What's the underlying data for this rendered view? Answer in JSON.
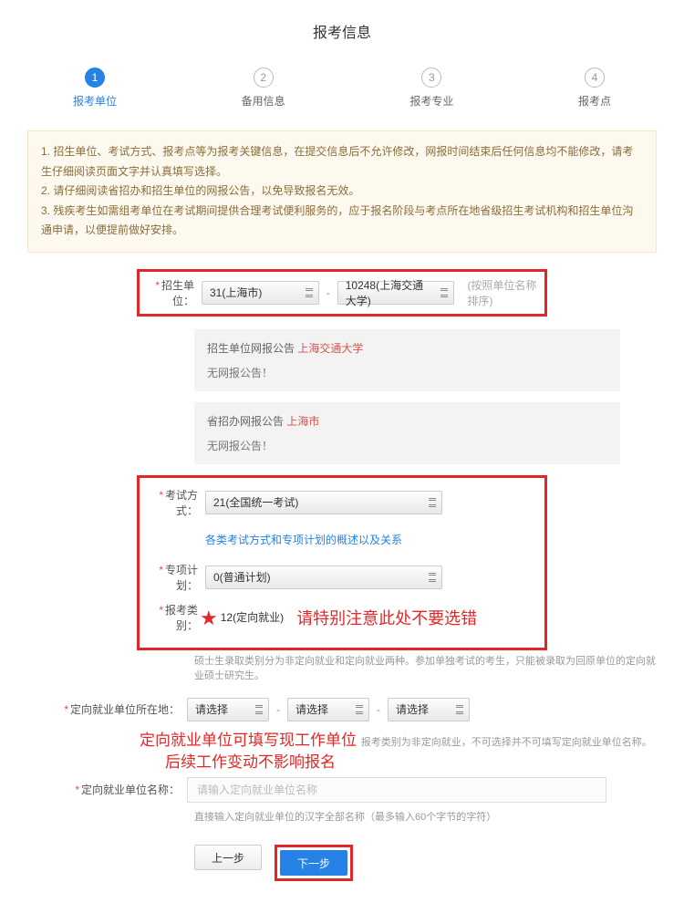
{
  "title": "报考信息",
  "steps": [
    {
      "num": "1",
      "label": "报考单位",
      "active": true
    },
    {
      "num": "2",
      "label": "备用信息",
      "active": false
    },
    {
      "num": "3",
      "label": "报考专业",
      "active": false
    },
    {
      "num": "4",
      "label": "报考点",
      "active": false
    }
  ],
  "infoBox": {
    "line1": "1. 招生单位、考试方式、报考点等为报考关键信息，在提交信息后不允许修改，网报时间结束后任何信息均不能修改，请考生仔细阅读页面文字并认真填写选择。",
    "line2": "2. 请仔细阅读省招办和招生单位的网报公告，以免导致报名无效。",
    "line3": "3. 残疾考生如需组考单位在考试期间提供合理考试便利服务的，应于报名阶段与考点所在地省级招生考试机构和招生单位沟通申请，以便提前做好安排。"
  },
  "fields": {
    "unit": {
      "label": "招生单位：",
      "province": "31(上海市)",
      "school": "10248(上海交通大学)",
      "hint": "(按照单位名称排序)"
    },
    "unitNotice": {
      "titlePrefix": "招生单位网报公告 ",
      "titleRed": "上海交通大学",
      "body": "无网报公告！"
    },
    "provNotice": {
      "titlePrefix": "省招办网报公告 ",
      "titleRed": "上海市",
      "body": "无网报公告！"
    },
    "exam": {
      "label": "考试方式：",
      "value": "21(全国统一考试)",
      "link": "各类考试方式和专项计划的概述以及关系"
    },
    "plan": {
      "label": "专项计划：",
      "value": "0(普通计划)"
    },
    "category": {
      "label": "报考类别：",
      "value": "12(定向就业)",
      "callout": "请特别注意此处不要选错"
    },
    "categoryNote": "硕士生录取类别分为非定向就业和定向就业两种。参加单独考试的考生，只能被录取为回原单位的定向就业硕士研究生。",
    "workLoc": {
      "label": "定向就业单位所在地：",
      "p1": "请选择",
      "p2": "请选择",
      "p3": "请选择"
    },
    "workLocCallout": {
      "line1": "定向就业单位可填写现工作单位",
      "line2": "后续工作变动不影响报名",
      "suffix": "报考类别为非定向就业，不可选择并不可填写定向就业单位名称。"
    },
    "workName": {
      "label": "定向就业单位名称：",
      "placeholder": "请输入定向就业单位名称",
      "note": "直接输入定向就业单位的汉字全部名称（最多输入60个字节的字符）"
    },
    "buttons": {
      "prev": "上一步",
      "next": "下一步"
    }
  }
}
